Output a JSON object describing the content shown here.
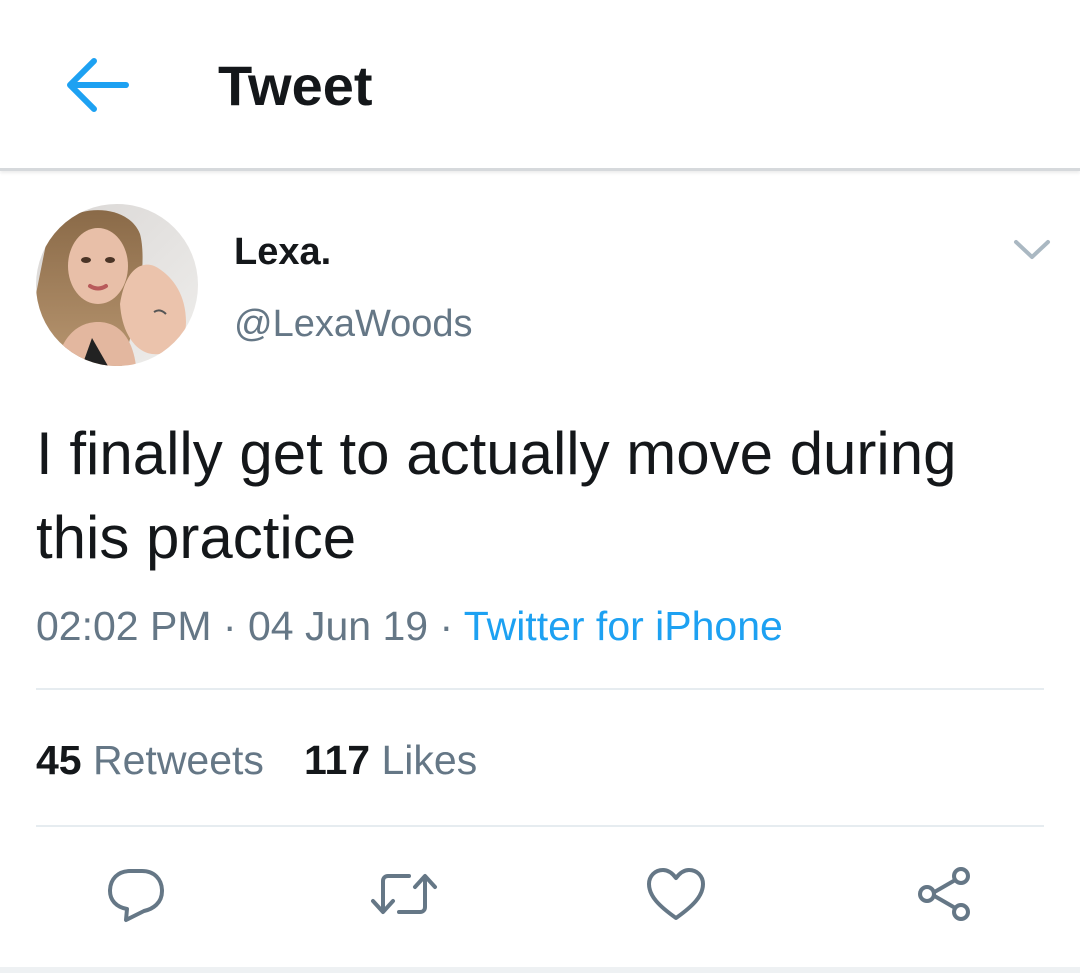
{
  "header": {
    "title": "Tweet",
    "back_icon": "arrow-left-icon",
    "accent_color": "#1da1f2"
  },
  "author": {
    "display_name": "Lexa.",
    "handle": "@LexaWoods"
  },
  "tweet": {
    "text": "I finally get to actually move during this practice",
    "time": "02:02 PM",
    "date": "04 Jun 19",
    "separator": "·",
    "source": "Twitter for iPhone"
  },
  "stats": {
    "retweets_count": "45",
    "retweets_label": "Retweets",
    "likes_count": "117",
    "likes_label": "Likes"
  },
  "actions": {
    "reply_icon": "reply-icon",
    "retweet_icon": "retweet-icon",
    "like_icon": "heart-icon",
    "share_icon": "share-icon"
  }
}
